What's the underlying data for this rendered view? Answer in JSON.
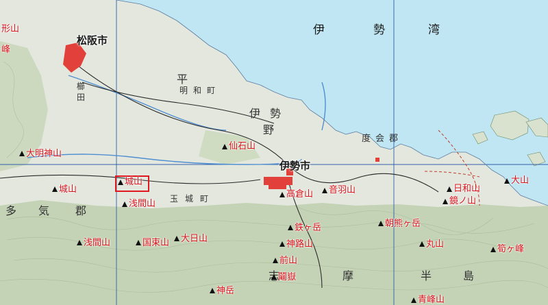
{
  "water": {
    "bay_name": [
      "伊",
      "勢",
      "湾"
    ]
  },
  "cities": {
    "matsusaka": "松阪市",
    "ise": "伊勢市"
  },
  "districts": {
    "taki": [
      "多",
      "気",
      "郡"
    ],
    "watarai": [
      "度",
      "会",
      "郡"
    ]
  },
  "plains": {
    "ise_plain": [
      "伊",
      "勢",
      "平",
      "野"
    ]
  },
  "peninsula": [
    "志",
    "摩",
    "半",
    "島"
  ],
  "places": {
    "kushida": [
      "櫛",
      "田"
    ],
    "meiwa": [
      "明",
      "和",
      "町"
    ],
    "tamaki": [
      "玉",
      "城",
      "町"
    ]
  },
  "edge_labels": {
    "left_top": "形山",
    "left_second": "峰"
  },
  "features": [
    {
      "id": "daimyojinsan",
      "label": "大明神山"
    },
    {
      "id": "shiroyama-west",
      "label": "城山"
    },
    {
      "id": "shiroyama-center",
      "label": "城山"
    },
    {
      "id": "asamayama-center",
      "label": "浅間山"
    },
    {
      "id": "asamayama-south",
      "label": "浅間山"
    },
    {
      "id": "kunitsukayama",
      "label": "国束山"
    },
    {
      "id": "ohikayama",
      "label": "大日山"
    },
    {
      "id": "takakurayama",
      "label": "高倉山"
    },
    {
      "id": "otowasan",
      "label": "音羽山"
    },
    {
      "id": "sengoku",
      "label": "仙石山"
    },
    {
      "id": "kanegatake",
      "label": "鉄ヶ岳"
    },
    {
      "id": "kanjisan",
      "label": "神路山"
    },
    {
      "id": "maeyama",
      "label": "前山"
    },
    {
      "id": "tsushima",
      "label": "鬮嶽"
    },
    {
      "id": "kamitake",
      "label": "神岳"
    },
    {
      "id": "asamagatake",
      "label": "朝熊ヶ岳"
    },
    {
      "id": "maruyama",
      "label": "丸山"
    },
    {
      "id": "hiyoriyama",
      "label": "日和山"
    },
    {
      "id": "kagamiyama",
      "label": "鏡ノ山"
    },
    {
      "id": "oyama",
      "label": "大山"
    },
    {
      "id": "aomine",
      "label": "青峰山"
    },
    {
      "id": "tsukunamine",
      "label": "筍ヶ峰"
    }
  ],
  "colors": {
    "sea": "#bfe6f2",
    "land": "#e3e7de",
    "hills": "#c4d3b6",
    "label_red": "#d8141c",
    "grid": "#2d5fa8"
  }
}
